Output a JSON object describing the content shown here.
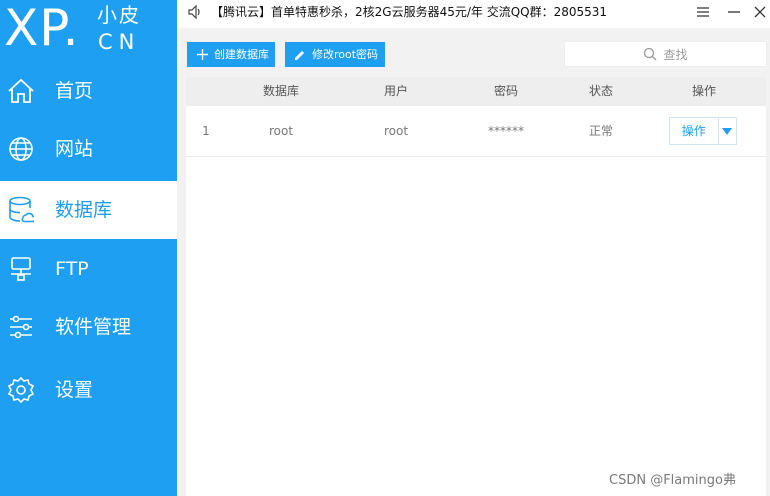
{
  "logo": {
    "xp": "XP.",
    "cn_top": "小皮",
    "cn_bottom": "CN"
  },
  "sidebar": {
    "items": [
      {
        "label": "首页",
        "icon": "home-icon",
        "active": false
      },
      {
        "label": "网站",
        "icon": "globe-icon",
        "active": false
      },
      {
        "label": "数据库",
        "icon": "database-icon",
        "active": true
      },
      {
        "label": "FTP",
        "icon": "ftp-server-icon",
        "active": false
      },
      {
        "label": "软件管理",
        "icon": "sliders-icon",
        "active": false
      },
      {
        "label": "设置",
        "icon": "gear-icon",
        "active": false
      }
    ]
  },
  "topbar": {
    "announcement": "【腾讯云】首单特惠秒杀，2核2G云服务器45元/年 交流QQ群：2805531"
  },
  "toolbar": {
    "create_label": "创建数据库",
    "modify_label": "修改root密码",
    "search_placeholder": "查找"
  },
  "table": {
    "columns": [
      "数据库",
      "用户",
      "密码",
      "状态",
      "操作"
    ],
    "rows": [
      {
        "index": "1",
        "database": "root",
        "user": "root",
        "password": "******",
        "status": "正常",
        "action": "操作"
      }
    ]
  },
  "watermark": "CSDN @Flamingo弗",
  "colors": {
    "accent": "#1e9ff2",
    "header_bg": "#eeeeee",
    "content_bg": "#f2f2f2"
  }
}
